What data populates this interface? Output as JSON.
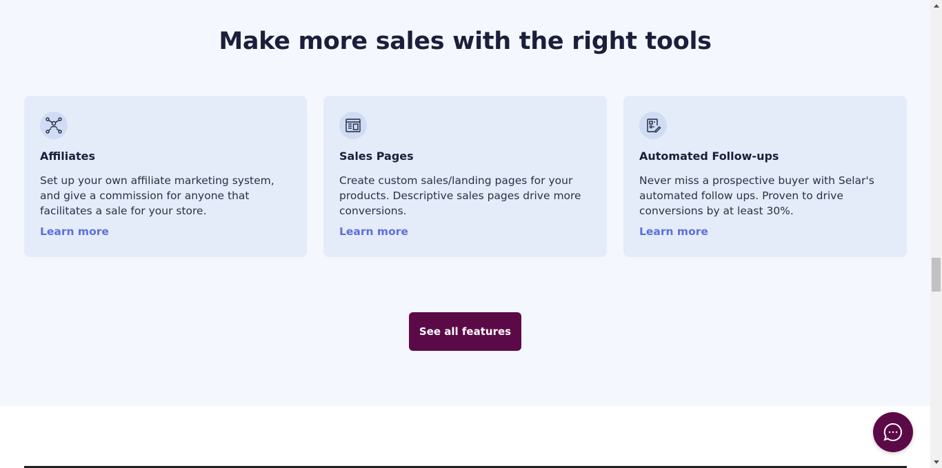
{
  "section": {
    "heading": "Make more sales with the right tools"
  },
  "cards": [
    {
      "icon": "network-icon",
      "title": "Affiliates",
      "description": "Set up your own affiliate marketing system, and give a commission for anyone that facilitates a sale for your store.",
      "link": "Learn more"
    },
    {
      "icon": "sales-page-icon",
      "title": "Sales Pages",
      "description": "Create custom sales/landing pages for your products. Descriptive sales pages drive more conversions.",
      "link": "Learn more"
    },
    {
      "icon": "document-edit-icon",
      "title": "Automated Follow-ups",
      "description": "Never miss a prospective buyer with Selar's automated follow ups. Proven to drive conversions by at least 30%.",
      "link": "Learn more"
    }
  ],
  "cta": {
    "label": "See all features"
  },
  "chat": {
    "icon": "chat-bubble-icon"
  },
  "colors": {
    "section_bg": "#f4f7fd",
    "card_bg": "#e4ecfa",
    "brand": "#5c0a47",
    "link": "#5d6fd8",
    "heading": "#1b1f3b"
  }
}
